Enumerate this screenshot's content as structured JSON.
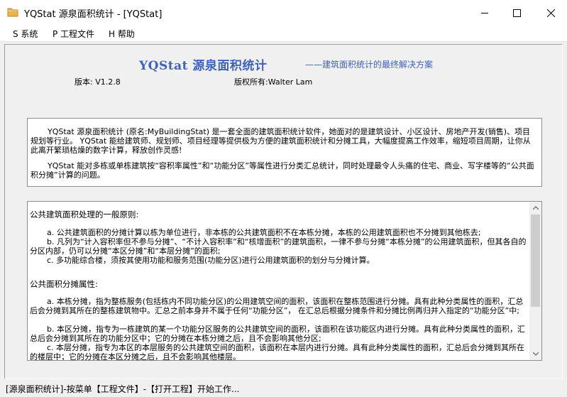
{
  "window": {
    "title": "YQStat 源泉面积统计 - [YQStat]",
    "icon": "folder-icon"
  },
  "menu": [
    {
      "label": "S 系统"
    },
    {
      "label": "P 工程文件"
    },
    {
      "label": "H 帮助"
    }
  ],
  "header": {
    "app_name": "YQStat 源泉面积统计",
    "slogan": "——建筑面积统计的最终解决方案",
    "version": "版本: V1.2.8",
    "copyright": "版权所有:Walter Lam"
  },
  "intro": {
    "paragraph1": "YQStat 源泉面积统计 (原名:MyBuildingStat) 是一套全面的建筑面积统计软件，她面对的是建筑设计、小区设计、房地产开发(销售)、项目规划等行业。 YQStat 能给建筑师、规划师、项目经理等提供极为方便的建筑面积统计和分摊工具，大幅度提高工作效率，缩短项目周期，让你从此离开繁琐枯燥的数字计算，释放创作灵感!",
    "paragraph2": "YQStat 能对多栋或单栋建筑按“容积率属性”和“功能分区”等属性进行分类汇总统计，同时处理最令人头痛的住宅、商业、写字楼等的“公共面积分摊”计算的问题。"
  },
  "rules": {
    "heading1": "公共建筑面积处理的一般原则:",
    "line_a": "a. 公共建筑面积的分摊计算以栋为单位进行，非本栋的公共建筑面积不在本栋分摊，本栋的公用建筑面积也不分摊到其他栋去;",
    "line_b": "b. 凡列为“计入容积率但不参与分摊”、“不计入容积率”和“核增面积”的建筑面积，一律不参与分摊“本栋分摊”的公用建筑面积，但其各自的分区内部，仍可以分摊“本区分摊”和“本层分摊”的面积;",
    "line_c": "c. 多功能综合楼，须按其使用功能和服务范围(功能分区)进行公用建筑面积的划分与分摊计算。",
    "heading2": "公共面积分摊属性:",
    "attr_a": "a. 本栋分摊，指为整栋服务(包括栋内不同功能分区)的公用建筑空间的面积，该面积在整栋范围进行分摊。具有此种分类属性的面积，汇总后会分摊到其所在的整栋建筑物中。汇总之前本身并不属于任何“功能分区”， 在汇总后根据分摊条件和分摊比例再归并入指定的“功能分区”中;",
    "attr_b": "b. 本区分摊，指专为一栋建筑的某一个功能分区服务的公共建筑空间的面积，该面积在该功能区内进行分摊。具有此种分类属性的面积，汇总后会分摊到其所在的功能分区中；它的分摊在本栋分摊之后，且不会影响其他分区;",
    "attr_c": "c. 本层分摊，指专为本区的本层服务的公共建筑空间的面积，该面积在本层内进行分摊。具有此种分类属性的面积，汇总后会分摊到其所在的楼层中；它的分摊在本区分摊之后，且不会影响其他楼层。"
  },
  "statusbar": {
    "text": "[源泉面积统计]-按菜单【工程文件】-【打开工程】开始工作..."
  },
  "colors": {
    "accent": "#3f63b8",
    "background": "#f0f0f0"
  }
}
